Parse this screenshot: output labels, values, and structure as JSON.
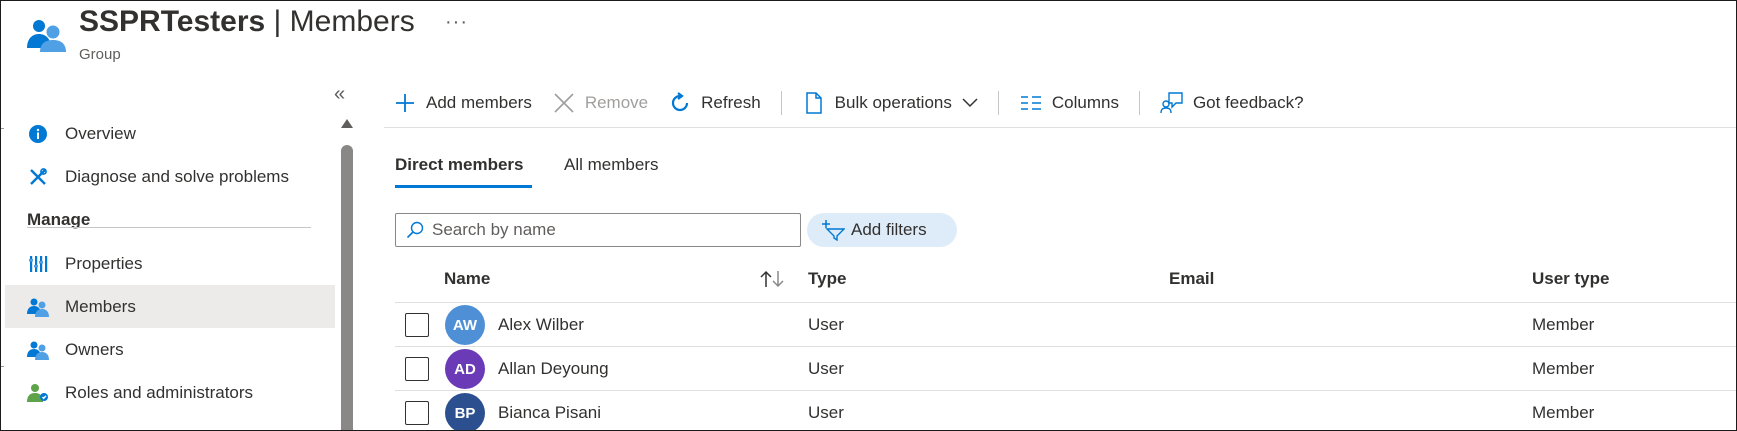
{
  "header": {
    "title_bold": "SSPRTesters",
    "title_sep": " | ",
    "title_rest": "Members",
    "more": "···",
    "subtitle": "Group"
  },
  "sidebar": {
    "collapse": "«",
    "items_top": [
      {
        "label": "Overview",
        "icon": "info-icon"
      },
      {
        "label": "Diagnose and solve problems",
        "icon": "wrench-icon"
      }
    ],
    "section": "Manage",
    "items_manage": [
      {
        "label": "Properties",
        "icon": "properties-icon"
      },
      {
        "label": "Members",
        "icon": "members-icon",
        "active": true
      },
      {
        "label": "Owners",
        "icon": "owners-icon"
      },
      {
        "label": "Roles and administrators",
        "icon": "roles-icon"
      }
    ]
  },
  "toolbar": {
    "add": "Add members",
    "remove": "Remove",
    "refresh": "Refresh",
    "bulk": "Bulk operations",
    "columns": "Columns",
    "feedback": "Got feedback?"
  },
  "tabs": {
    "direct": "Direct members",
    "all": "All members"
  },
  "search": {
    "placeholder": "Search by name",
    "value": ""
  },
  "filters": {
    "label": "Add filters"
  },
  "table": {
    "headers": {
      "name": "Name",
      "type": "Type",
      "email": "Email",
      "user_type": "User type"
    },
    "rows": [
      {
        "initials": "AW",
        "name": "Alex Wilber",
        "type": "User",
        "email": "",
        "user_type": "Member",
        "color": "#4f8fd6"
      },
      {
        "initials": "AD",
        "name": "Allan Deyoung",
        "type": "User",
        "email": "",
        "user_type": "Member",
        "color": "#6b3ab6"
      },
      {
        "initials": "BP",
        "name": "Bianca Pisani",
        "type": "User",
        "email": "",
        "user_type": "Member",
        "color": "#2b4f8f"
      }
    ]
  },
  "colors": {
    "accent": "#0078d4",
    "filter_bg": "#deecf9",
    "active_nav_bg": "#edebe9"
  }
}
